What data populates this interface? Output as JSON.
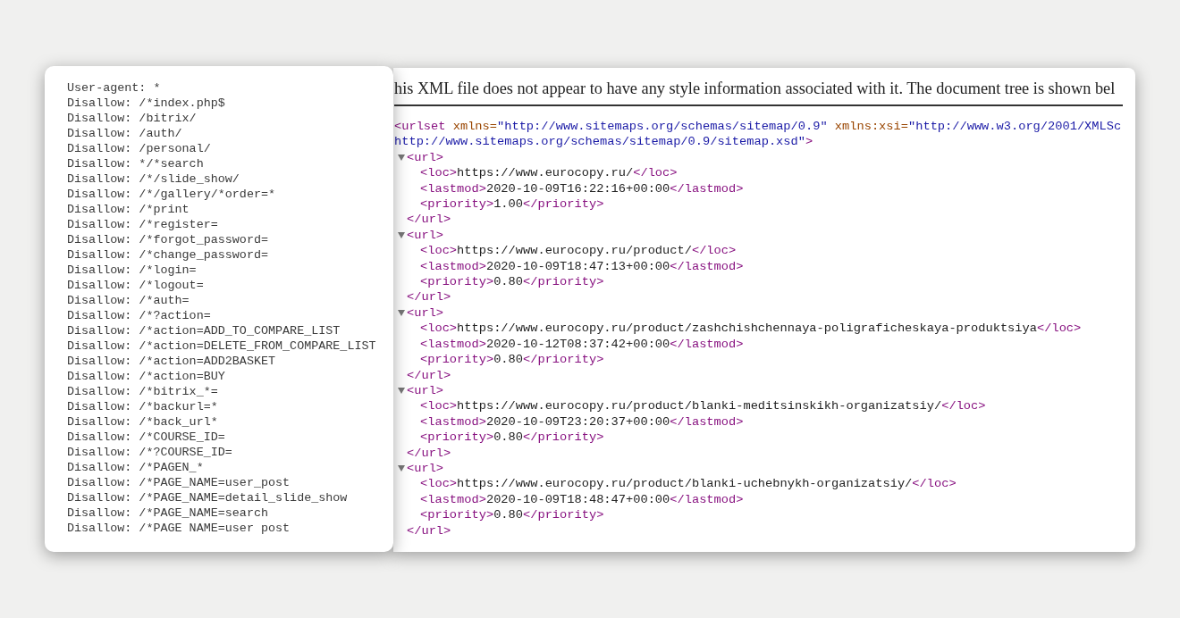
{
  "robots_panel": {
    "lines": [
      "User-agent: *",
      "Disallow: /*index.php$",
      "Disallow: /bitrix/",
      "Disallow: /auth/",
      "Disallow: /personal/",
      "Disallow: */*search",
      "Disallow: /*/slide_show/",
      "Disallow: /*/gallery/*order=*",
      "Disallow: /*print",
      "Disallow: /*register=",
      "Disallow: /*forgot_password=",
      "Disallow: /*change_password=",
      "Disallow: /*login=",
      "Disallow: /*logout=",
      "Disallow: /*auth=",
      "Disallow: /*?action=",
      "Disallow: /*action=ADD_TO_COMPARE_LIST",
      "Disallow: /*action=DELETE_FROM_COMPARE_LIST",
      "Disallow: /*action=ADD2BASKET",
      "Disallow: /*action=BUY",
      "Disallow: /*bitrix_*=",
      "Disallow: /*backurl=*",
      "Disallow: /*back_url*",
      "Disallow: /*COURSE_ID=",
      "Disallow: /*?COURSE_ID=",
      "Disallow: /*PAGEN_*",
      "Disallow: /*PAGE_NAME=user_post",
      "Disallow: /*PAGE_NAME=detail_slide_show",
      "Disallow: /*PAGE_NAME=search",
      "Disallow: /*PAGE NAME=user post"
    ]
  },
  "xml_viewer": {
    "notice": "his XML file does not appear to have any style information associated with it. The document tree is shown bel",
    "root": {
      "open_lines": [
        [
          {
            "kind": "tag",
            "text": "<urlset"
          },
          {
            "kind": "attr_name",
            "text": " xmlns="
          },
          {
            "kind": "attr_value",
            "text": "\"http://www.sitemaps.org/schemas/sitemap/0.9\""
          },
          {
            "kind": "attr_name",
            "text": " xmlns:xsi="
          },
          {
            "kind": "attr_value",
            "text": "\"http://www.w3.org/2001/XMLSc"
          }
        ],
        [
          {
            "kind": "attr_value",
            "text": "http://www.sitemaps.org/schemas/sitemap/0.9/sitemap.xsd\""
          },
          {
            "kind": "tag",
            "text": ">"
          }
        ]
      ],
      "children": [
        {
          "expanded": true,
          "open": [
            {
              "kind": "tag",
              "text": "<url>"
            }
          ],
          "close": [
            {
              "kind": "tag",
              "text": "</url>"
            }
          ],
          "children": [
            {
              "tokens": [
                {
                  "kind": "tag",
                  "text": "<loc>"
                },
                {
                  "kind": "text",
                  "text": "https://www.eurocopy.ru/"
                },
                {
                  "kind": "tag",
                  "text": "</loc>"
                }
              ]
            },
            {
              "tokens": [
                {
                  "kind": "tag",
                  "text": "<lastmod>"
                },
                {
                  "kind": "text",
                  "text": "2020-10-09T16:22:16+00:00"
                },
                {
                  "kind": "tag",
                  "text": "</lastmod>"
                }
              ]
            },
            {
              "tokens": [
                {
                  "kind": "tag",
                  "text": "<priority>"
                },
                {
                  "kind": "text",
                  "text": "1.00"
                },
                {
                  "kind": "tag",
                  "text": "</priority>"
                }
              ]
            }
          ]
        },
        {
          "expanded": true,
          "open": [
            {
              "kind": "tag",
              "text": "<url>"
            }
          ],
          "close": [
            {
              "kind": "tag",
              "text": "</url>"
            }
          ],
          "children": [
            {
              "tokens": [
                {
                  "kind": "tag",
                  "text": "<loc>"
                },
                {
                  "kind": "text",
                  "text": "https://www.eurocopy.ru/product/"
                },
                {
                  "kind": "tag",
                  "text": "</loc>"
                }
              ]
            },
            {
              "tokens": [
                {
                  "kind": "tag",
                  "text": "<lastmod>"
                },
                {
                  "kind": "text",
                  "text": "2020-10-09T18:47:13+00:00"
                },
                {
                  "kind": "tag",
                  "text": "</lastmod>"
                }
              ]
            },
            {
              "tokens": [
                {
                  "kind": "tag",
                  "text": "<priority>"
                },
                {
                  "kind": "text",
                  "text": "0.80"
                },
                {
                  "kind": "tag",
                  "text": "</priority>"
                }
              ]
            }
          ]
        },
        {
          "expanded": true,
          "open": [
            {
              "kind": "tag",
              "text": "<url>"
            }
          ],
          "close": [
            {
              "kind": "tag",
              "text": "</url>"
            }
          ],
          "children": [
            {
              "tokens": [
                {
                  "kind": "tag",
                  "text": "<loc>"
                },
                {
                  "kind": "text",
                  "text": "https://www.eurocopy.ru/product/zashchishchennaya-poligraficheskaya-produktsiya"
                },
                {
                  "kind": "tag",
                  "text": "</loc>"
                }
              ]
            },
            {
              "tokens": [
                {
                  "kind": "tag",
                  "text": "<lastmod>"
                },
                {
                  "kind": "text",
                  "text": "2020-10-12T08:37:42+00:00"
                },
                {
                  "kind": "tag",
                  "text": "</lastmod>"
                }
              ]
            },
            {
              "tokens": [
                {
                  "kind": "tag",
                  "text": "<priority>"
                },
                {
                  "kind": "text",
                  "text": "0.80"
                },
                {
                  "kind": "tag",
                  "text": "</priority>"
                }
              ]
            }
          ]
        },
        {
          "expanded": true,
          "open": [
            {
              "kind": "tag",
              "text": "<url>"
            }
          ],
          "close": [
            {
              "kind": "tag",
              "text": "</url>"
            }
          ],
          "children": [
            {
              "tokens": [
                {
                  "kind": "tag",
                  "text": "<loc>"
                },
                {
                  "kind": "text",
                  "text": "https://www.eurocopy.ru/product/blanki-meditsinskikh-organizatsiy/"
                },
                {
                  "kind": "tag",
                  "text": "</loc>"
                }
              ]
            },
            {
              "tokens": [
                {
                  "kind": "tag",
                  "text": "<lastmod>"
                },
                {
                  "kind": "text",
                  "text": "2020-10-09T23:20:37+00:00"
                },
                {
                  "kind": "tag",
                  "text": "</lastmod>"
                }
              ]
            },
            {
              "tokens": [
                {
                  "kind": "tag",
                  "text": "<priority>"
                },
                {
                  "kind": "text",
                  "text": "0.80"
                },
                {
                  "kind": "tag",
                  "text": "</priority>"
                }
              ]
            }
          ]
        },
        {
          "expanded": true,
          "open": [
            {
              "kind": "tag",
              "text": "<url>"
            }
          ],
          "close": [
            {
              "kind": "tag",
              "text": "</url>"
            }
          ],
          "children": [
            {
              "tokens": [
                {
                  "kind": "tag",
                  "text": "<loc>"
                },
                {
                  "kind": "text",
                  "text": "https://www.eurocopy.ru/product/blanki-uchebnykh-organizatsiy/"
                },
                {
                  "kind": "tag",
                  "text": "</loc>"
                }
              ]
            },
            {
              "tokens": [
                {
                  "kind": "tag",
                  "text": "<lastmod>"
                },
                {
                  "kind": "text",
                  "text": "2020-10-09T18:48:47+00:00"
                },
                {
                  "kind": "tag",
                  "text": "</lastmod>"
                }
              ]
            },
            {
              "tokens": [
                {
                  "kind": "tag",
                  "text": "<priority>"
                },
                {
                  "kind": "text",
                  "text": "0.80"
                },
                {
                  "kind": "tag",
                  "text": "</priority>"
                }
              ]
            }
          ]
        }
      ]
    }
  }
}
